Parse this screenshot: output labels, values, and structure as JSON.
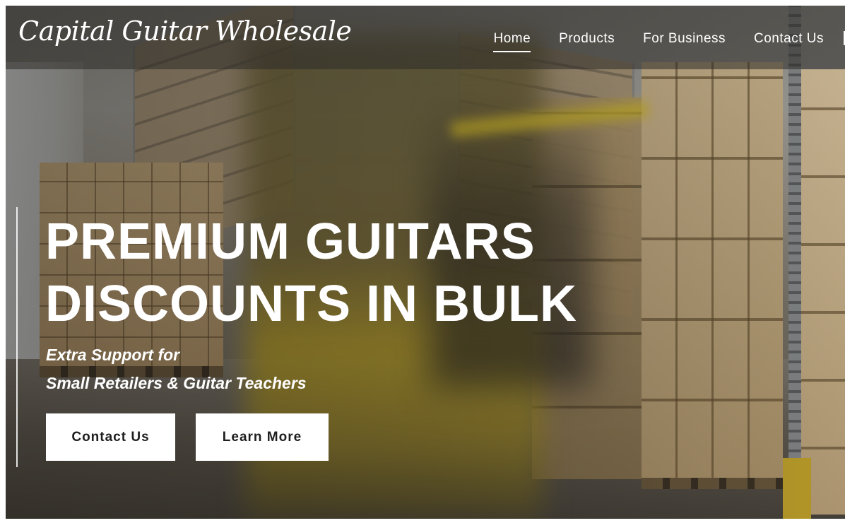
{
  "site": {
    "logo_text": "Capital Guitar Wholesale"
  },
  "nav": {
    "items": [
      {
        "label": "Home",
        "active": true
      },
      {
        "label": "Products",
        "active": false
      },
      {
        "label": "For Business",
        "active": false
      },
      {
        "label": "Contact Us",
        "active": false
      }
    ]
  },
  "hero": {
    "headline_line1": "PREMIUM GUITARS",
    "headline_line2": "DISCOUNTS IN BULK",
    "subtitle_line1": "Extra Support for",
    "subtitle_line2": "Small Retailers & Guitar Teachers",
    "buttons": {
      "contact_label": "Contact Us",
      "learn_label": "Learn More"
    },
    "background_image": "warehouse-forklift-scene"
  },
  "colors": {
    "header_overlay": "#2d2b28",
    "text": "#ffffff",
    "button_bg": "#ffffff",
    "button_text": "#1e1e1e"
  }
}
